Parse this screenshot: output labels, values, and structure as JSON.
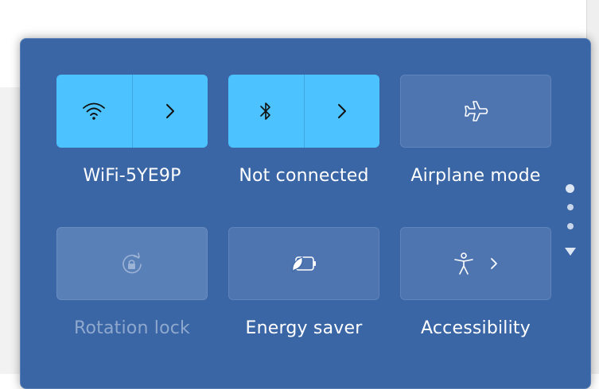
{
  "tiles": [
    {
      "label": "WiFi-5YE9P",
      "icon": "wifi-icon",
      "state": "on",
      "has_expand": true
    },
    {
      "label": "Not connected",
      "icon": "bluetooth-icon",
      "state": "on",
      "has_expand": true
    },
    {
      "label": "Airplane mode",
      "icon": "airplane-icon",
      "state": "off",
      "has_expand": false
    },
    {
      "label": "Rotation lock",
      "icon": "rotation-lock-icon",
      "state": "disabled",
      "has_expand": false
    },
    {
      "label": "Energy saver",
      "icon": "energy-saver-icon",
      "state": "off",
      "has_expand": false
    },
    {
      "label": "Accessibility",
      "icon": "accessibility-icon",
      "state": "off",
      "has_expand": true
    }
  ],
  "pager": {
    "pages": 3,
    "current": 1
  },
  "colors": {
    "panel": "#3a66a6",
    "tile_on": "#4cc2ff",
    "tile_off": "#4e75b0",
    "text": "#ffffff",
    "text_disabled": "#8fa8cd"
  }
}
